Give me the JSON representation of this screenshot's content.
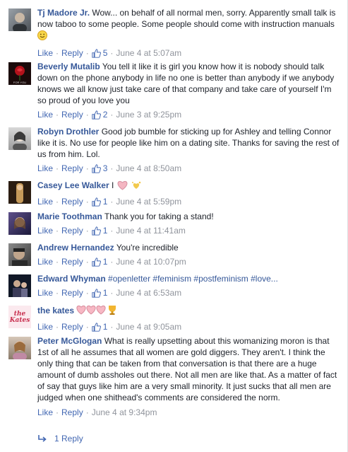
{
  "comments": [
    {
      "name": "Tj Madore Jr.",
      "text": "Wow... on behalf of all normal men, sorry. Apparently small talk is now taboo to some people. Some people should come with instruction manuals",
      "like": "Like",
      "reply": "Reply",
      "likes": "5",
      "time": "June 4 at 5:07am"
    },
    {
      "name": "Beverly Mutalib",
      "text": "You tell it like it is girl you know how it is nobody should talk down on the phone anybody in life no one is better than anybody if we anybody knows we all know just take care of that company and take care of yourself I'm so proud of you love you",
      "like": "Like",
      "reply": "Reply",
      "likes": "2",
      "time": "June 3 at 9:25pm",
      "avatar_text": "FOR YOU"
    },
    {
      "name": "Robyn Drothler",
      "text": "Good job bumble for sticking up for Ashley and telling Connor like it is. No use for people like him on a dating site. Thanks for saving the rest of us from him. Lol.",
      "like": "Like",
      "reply": "Reply",
      "likes": "3",
      "time": "June 4 at 8:50am"
    },
    {
      "name": "Casey Lee Walker",
      "text": "I",
      "like": "Like",
      "reply": "Reply",
      "likes": "1",
      "time": "June 4 at 5:59pm"
    },
    {
      "name": "Marie Toothman",
      "text": "Thank you for taking a stand!",
      "like": "Like",
      "reply": "Reply",
      "likes": "1",
      "time": "June 4 at 11:41am"
    },
    {
      "name": "Andrew Hernandez",
      "text": "You're incredible",
      "like": "Like",
      "reply": "Reply",
      "likes": "1",
      "time": "June 4 at 10:07pm"
    },
    {
      "name": "Edward Whyman",
      "text": "#openletter #feminism #postfeminism #love...",
      "like": "Like",
      "reply": "Reply",
      "likes": "1",
      "time": "June 4 at 6:53am"
    },
    {
      "name": "the kates",
      "text": "",
      "like": "Like",
      "reply": "Reply",
      "likes": "1",
      "time": "June 4 at 9:05am",
      "avatar_text": "the Kates"
    },
    {
      "name": "Peter McGlogan",
      "text": "What is really upsetting about this womanizing moron is that 1st of all he assumes that all women are gold diggers. They aren't. I think the only thing that can be taken from that conversation is that there are a huge amount of dumb assholes out there. Not all men are like that. As a matter of fact of say that guys like him are a very small minority. It just sucks that all men are judged when one shithead's comments are considered the norm.",
      "like": "Like",
      "reply": "Reply",
      "time": "June 4 at 9:34pm"
    }
  ],
  "replies_label": "1 Reply",
  "colors": {
    "link": "#365899",
    "action": "#4267b2",
    "meta": "#90949c",
    "text": "#1d2129"
  }
}
